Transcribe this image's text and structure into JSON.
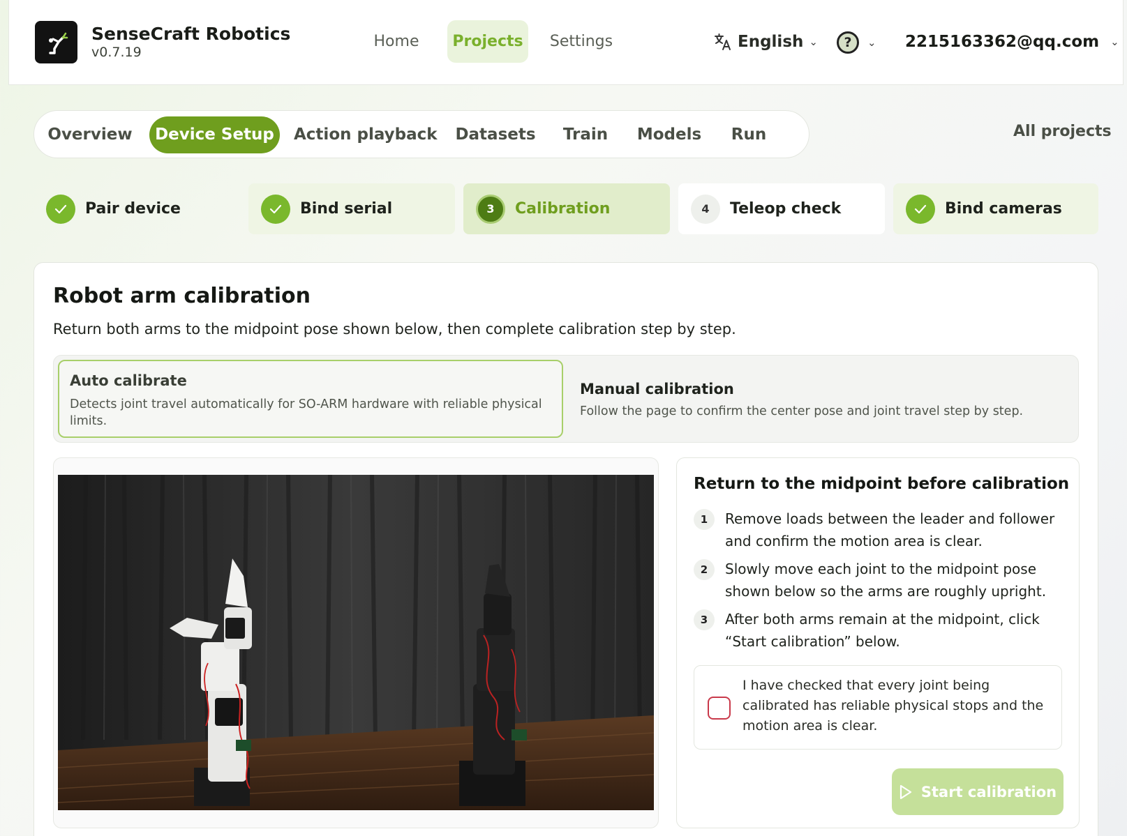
{
  "brand": {
    "name": "SenseCraft Robotics",
    "version": "v0.7.19"
  },
  "nav": {
    "home": "Home",
    "projects": "Projects",
    "settings": "Settings"
  },
  "language": {
    "label": "English",
    "icon": "translate-icon"
  },
  "help": {
    "symbol": "?",
    "icon": "help-icon"
  },
  "account": {
    "email": "2215163362@qq.com"
  },
  "tabs": [
    {
      "label": "Overview",
      "active": false
    },
    {
      "label": "Device Setup",
      "active": true
    },
    {
      "label": "Action playback",
      "active": false
    },
    {
      "label": "Datasets",
      "active": false
    },
    {
      "label": "Train",
      "active": false
    },
    {
      "label": "Models",
      "active": false
    },
    {
      "label": "Run",
      "active": false
    }
  ],
  "all_projects": "All projects",
  "steps": [
    {
      "label": "Pair device",
      "status": "done",
      "number": ""
    },
    {
      "label": "Bind serial",
      "status": "done",
      "number": ""
    },
    {
      "label": "Calibration",
      "status": "current",
      "number": "3"
    },
    {
      "label": "Teleop check",
      "status": "pending",
      "number": "4"
    },
    {
      "label": "Bind cameras",
      "status": "done",
      "number": ""
    }
  ],
  "calibration": {
    "title": "Robot arm calibration",
    "description": "Return both arms to the midpoint pose shown below, then complete calibration step by step.",
    "modes": {
      "auto": {
        "title": "Auto calibrate",
        "description": "Detects joint travel automatically for SO-ARM hardware with reliable physical limits.",
        "selected": true
      },
      "manual": {
        "title": "Manual calibration",
        "description": "Follow the page to confirm the center pose and joint travel step by step.",
        "selected": false
      }
    },
    "instructions": {
      "title": "Return to the midpoint before calibration",
      "steps": [
        {
          "number": "1",
          "text": "Remove loads between the leader and follower and confirm the motion area is clear."
        },
        {
          "number": "2",
          "text": "Slowly move each joint to the midpoint pose shown below so the arms are roughly upright."
        },
        {
          "number": "3",
          "text": "After both arms remain at the midpoint, click “Start calibration” below."
        }
      ],
      "confirm": {
        "text": "I have checked that every joint being calibrated has reliable physical stops and the motion area is clear.",
        "checked": false
      },
      "start_button": "Start calibration"
    }
  },
  "colors": {
    "accent": "#6f9e1e",
    "accent_light": "#7ab02c",
    "start_button_disabled": "#c5e09a",
    "checkbox_border": "#c9394a"
  }
}
